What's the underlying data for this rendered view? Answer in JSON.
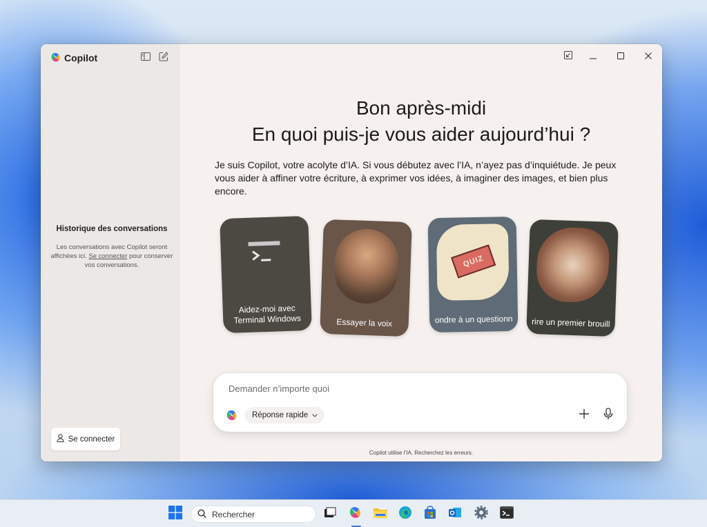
{
  "app": {
    "name": "Copilot"
  },
  "sidebar": {
    "history_title": "Historique des conversations",
    "history_text_1": "Les conversations avec Copilot seront affichées ici.",
    "history_link": "Se connecter",
    "history_text_2": "pour conserver vos conversations.",
    "connect_button": "Se connecter"
  },
  "main": {
    "greeting_line1": "Bon après-midi",
    "greeting_line2": "En quoi puis-je vous aider aujourd’hui ?",
    "intro": "Je suis Copilot, votre acolyte d’IA. Si vous débutez avec l’IA, n’ayez pas d’inquiétude. Je peux vous aider à affiner votre écriture, à exprimer vos idées, à imaginer des images, et bien plus encore.",
    "cards": [
      {
        "label": "Aidez-moi avec Terminal Windows",
        "color": "#4b4941"
      },
      {
        "label": "Essayer la voix",
        "color": "#6a5549"
      },
      {
        "label": "ondre à un questionn",
        "color": "#5f6b76"
      },
      {
        "label": "rire un premier brouill",
        "color": "#3e3f38"
      }
    ],
    "input_placeholder": "Demander n’importe quoi",
    "mode_label": "Réponse rapide",
    "disclaimer": "Copilot utilise l’IA. Recherchez les erreurs."
  },
  "taskbar": {
    "search_label": "Rechercher"
  },
  "colors": {
    "window_bg": "#f6f1ef",
    "sidebar_bg": "#ebe8e6",
    "accent": "#3b6fd6"
  }
}
